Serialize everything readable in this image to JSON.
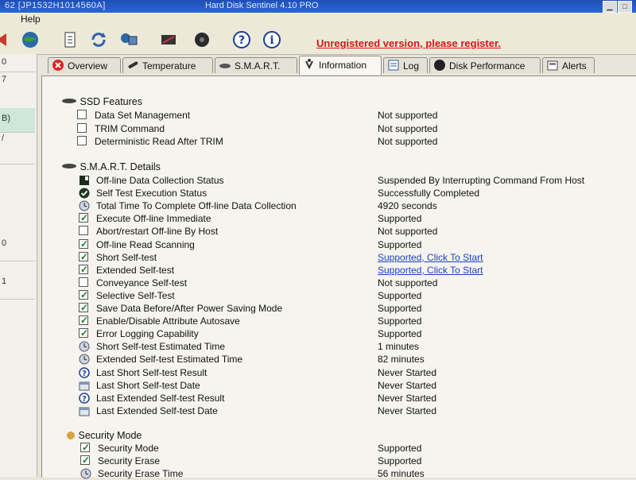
{
  "window": {
    "title_prefix": "62 [JP1532H1014560A]",
    "title": "Hard Disk Sentinel 4.10 PRO"
  },
  "menu": {
    "help": "Help"
  },
  "toolbar": {
    "unregistered": "Unregistered version, please register."
  },
  "leftpane": {
    "items": [
      "0",
      "7",
      "B)",
      "/",
      "0",
      "1"
    ]
  },
  "tabs": [
    {
      "label": "Overview",
      "icon": "x-circle-icon"
    },
    {
      "label": "Temperature",
      "icon": "thermometer-icon"
    },
    {
      "label": "S.M.A.R.T.",
      "icon": "disk-icon"
    },
    {
      "label": "Information",
      "icon": "info-icon"
    },
    {
      "label": "Log",
      "icon": "log-icon"
    },
    {
      "label": "Disk Performance",
      "icon": "performance-icon"
    },
    {
      "label": "Alerts",
      "icon": "alerts-icon"
    }
  ],
  "sections": {
    "ssd": "SSD Features",
    "smart": "S.M.A.R.T. Details",
    "security": "Security Mode"
  },
  "ssd_rows": [
    {
      "label": "Data Set Management",
      "value": "Not supported",
      "checked": false
    },
    {
      "label": "TRIM Command",
      "value": "Not supported",
      "checked": false
    },
    {
      "label": "Deterministic Read After TRIM",
      "value": "Not supported",
      "checked": false
    }
  ],
  "smart_rows": [
    {
      "label": "Off-line Data Collection Status",
      "value": "Suspended By Interrupting Command From Host",
      "kind": "icon",
      "icon": "status-icon"
    },
    {
      "label": "Self Test Execution Status",
      "value": "Successfully Completed",
      "kind": "icon",
      "icon": "check-circle-icon"
    },
    {
      "label": "Total Time To Complete Off-line Data Collection",
      "value": "4920 seconds",
      "kind": "icon",
      "icon": "clock-icon"
    },
    {
      "label": "Execute Off-line Immediate",
      "value": "Supported",
      "kind": "check",
      "checked": true
    },
    {
      "label": "Abort/restart Off-line By Host",
      "value": "Not supported",
      "kind": "check",
      "checked": false
    },
    {
      "label": "Off-line Read Scanning",
      "value": "Supported",
      "kind": "check",
      "checked": true
    },
    {
      "label": "Short Self-test",
      "value": "Supported, Click To Start",
      "kind": "check",
      "checked": true,
      "link": true
    },
    {
      "label": "Extended Self-test",
      "value": "Supported, Click To Start",
      "kind": "check",
      "checked": true,
      "link": true
    },
    {
      "label": "Conveyance Self-test",
      "value": "Not supported",
      "kind": "check",
      "checked": false
    },
    {
      "label": "Selective Self-Test",
      "value": "Supported",
      "kind": "check",
      "checked": true
    },
    {
      "label": "Save Data Before/After Power Saving Mode",
      "value": "Supported",
      "kind": "check",
      "checked": true
    },
    {
      "label": "Enable/Disable Attribute Autosave",
      "value": "Supported",
      "kind": "check",
      "checked": true
    },
    {
      "label": "Error Logging Capability",
      "value": "Supported",
      "kind": "check",
      "checked": true
    },
    {
      "label": "Short Self-test Estimated Time",
      "value": "1 minutes",
      "kind": "icon",
      "icon": "clock-icon"
    },
    {
      "label": "Extended Self-test Estimated Time",
      "value": "82 minutes",
      "kind": "icon",
      "icon": "clock-icon"
    },
    {
      "label": "Last Short Self-test Result",
      "value": "Never Started",
      "kind": "icon",
      "icon": "question-icon"
    },
    {
      "label": "Last Short Self-test Date",
      "value": "Never Started",
      "kind": "icon",
      "icon": "calendar-icon"
    },
    {
      "label": "Last Extended Self-test Result",
      "value": "Never Started",
      "kind": "icon",
      "icon": "question-icon"
    },
    {
      "label": "Last Extended Self-test Date",
      "value": "Never Started",
      "kind": "icon",
      "icon": "calendar-icon"
    }
  ],
  "security_rows": [
    {
      "label": "Security Mode",
      "value": "Supported",
      "kind": "check",
      "checked": true
    },
    {
      "label": "Security Erase",
      "value": "Supported",
      "kind": "check",
      "checked": true
    },
    {
      "label": "Security Erase Time",
      "value": "56 minutes",
      "kind": "icon",
      "icon": "clock-icon"
    }
  ],
  "colors": {
    "link": "#1b3fcc",
    "warning": "#d81414",
    "title": "#2b66d6"
  }
}
